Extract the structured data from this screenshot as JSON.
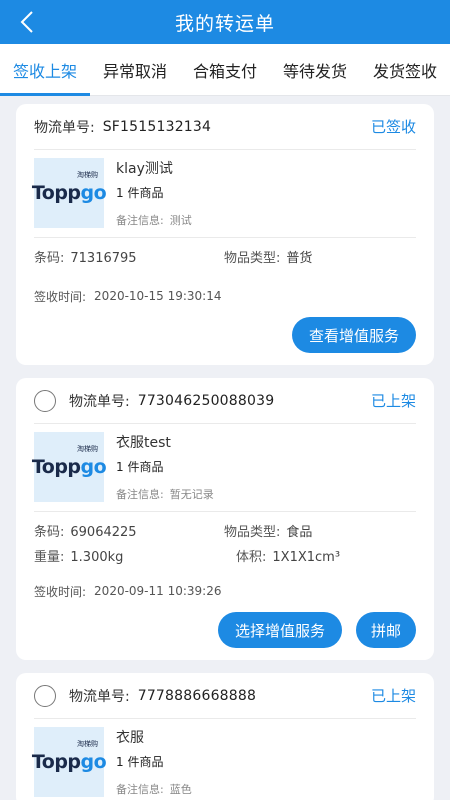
{
  "header": {
    "title": "我的转运单",
    "back_icon": "chevron-left-icon"
  },
  "tabs": [
    {
      "label": "签收上架",
      "active": true
    },
    {
      "label": "异常取消",
      "active": false
    },
    {
      "label": "合箱支付",
      "active": false
    },
    {
      "label": "等待发货",
      "active": false
    },
    {
      "label": "发货签收",
      "active": false
    }
  ],
  "labels": {
    "tracking": "物流单号:",
    "barcode": "条码:",
    "type": "物品类型:",
    "weight": "重量:",
    "volume": "体积:",
    "signed_time": "签收时间:",
    "note": "备注信息:"
  },
  "logo": {
    "main_a": "Topp",
    "main_b": "go",
    "cn": "淘梯购"
  },
  "cards": [
    {
      "tracking_no": "SF1515132134",
      "status": "已签收",
      "goods_name": "klay测试",
      "goods_count": "1 件商品",
      "note": "测试",
      "barcode": "71316795",
      "type": "普货",
      "signed_time": "2020-10-15 19:30:14",
      "button1": "查看增值服务"
    },
    {
      "tracking_no": "773046250088039",
      "status": "已上架",
      "goods_name": "衣服test",
      "goods_count": "1 件商品",
      "note": "暂无记录",
      "barcode": "69064225",
      "type": "食品",
      "weight": "1.300kg",
      "volume": "1X1X1cm³",
      "signed_time": "2020-09-11 10:39:26",
      "button1": "选择增值服务",
      "button2": "拼邮"
    },
    {
      "tracking_no": "7778886668888",
      "status": "已上架",
      "goods_name": "衣服",
      "goods_count": "1 件商品",
      "note": "蓝色"
    }
  ],
  "colors": {
    "accent": "#1d8ae3",
    "background": "#eef0f5"
  }
}
